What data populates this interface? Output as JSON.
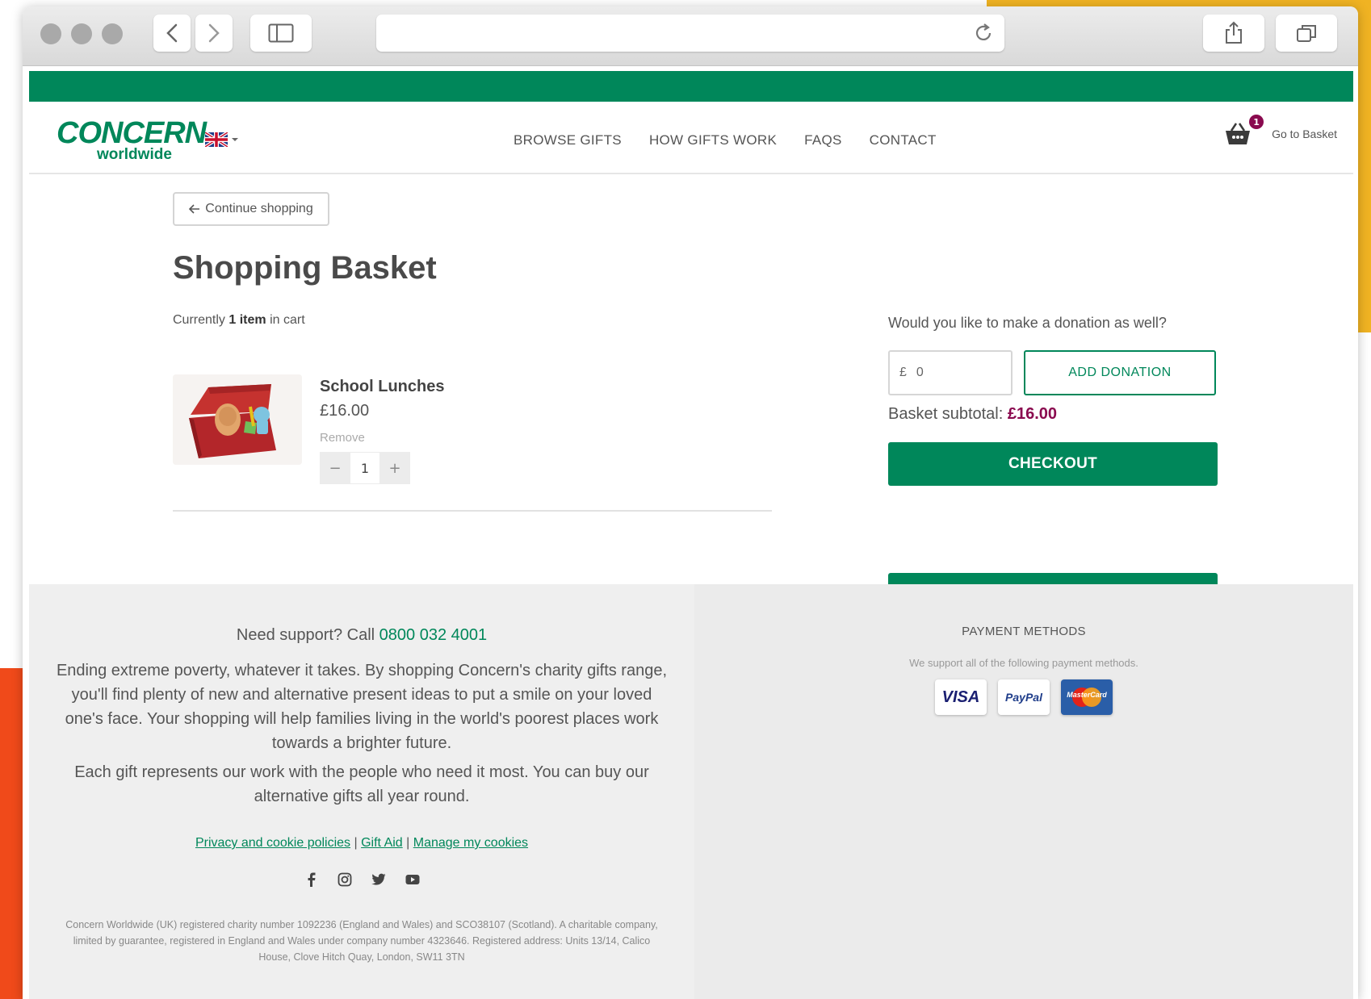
{
  "header": {
    "logo_main": "CONCERN",
    "logo_sub": "worldwide",
    "nav": [
      "BROWSE GIFTS",
      "HOW GIFTS WORK",
      "FAQS",
      "CONTACT"
    ],
    "basket_count": "1",
    "basket_label": "Go to Basket"
  },
  "main": {
    "continue_label": "Continue shopping",
    "title": "Shopping Basket",
    "count_prefix": "Currently",
    "count_value": "1 item",
    "count_suffix": "in cart",
    "item": {
      "name": "School Lunches",
      "price": "£16.00",
      "remove_label": "Remove",
      "quantity": "1",
      "minus": "−",
      "plus": "+"
    },
    "donation": {
      "question": "Would you like to make a donation as well?",
      "currency": "£",
      "value": "0",
      "button_label": "ADD DONATION"
    },
    "subtotal_label": "Basket subtotal:",
    "subtotal_value": "£16.00",
    "checkout_label": "CHECKOUT"
  },
  "footer": {
    "support_text": "Need support? Call",
    "support_phone": "0800 032 4001",
    "para1": "Ending extreme poverty, whatever it takes. By shopping Concern's charity gifts range, you'll find plenty of new and alternative present ideas to put a smile on your loved one's face. Your shopping will help families living in the world's poorest places work towards a brighter future.",
    "para2": "Each gift represents our work with the people who need it most. You can buy our alternative gifts all year round.",
    "links": [
      "Privacy and cookie policies",
      "Gift Aid",
      "Manage my cookies"
    ],
    "separator": "|",
    "social": [
      "facebook-icon",
      "instagram-icon",
      "twitter-icon",
      "youtube-icon"
    ],
    "legal": "Concern Worldwide (UK) registered charity number 1092236 (England and Wales) and SCO38107 (Scotland). A charitable company, limited by guarantee, registered in England and Wales under company number 4323646. Registered address: Units 13/14, Calico House, Clove Hitch Quay, London, SW11 3TN",
    "payment_title": "PAYMENT METHODS",
    "payment_sub": "We support all of the following payment methods.",
    "cards": [
      "VISA",
      "PayPal",
      "MasterCard"
    ]
  },
  "colors": {
    "brand_green": "#00875a",
    "accent_plum": "#8a0a4f",
    "deco_orange": "#f04a1a",
    "deco_yellow": "#f0b323"
  }
}
